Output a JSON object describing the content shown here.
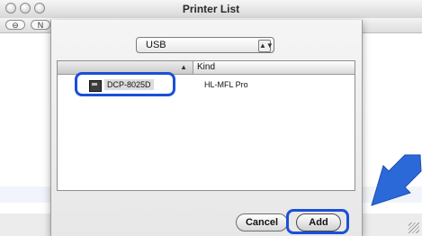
{
  "window": {
    "title": "Printer List",
    "toolbar_buttons": [
      "⊖",
      "N"
    ]
  },
  "sheet": {
    "connection_popup": {
      "selected": "USB"
    },
    "list": {
      "columns": [
        "",
        "Kind"
      ],
      "rows": [
        {
          "name": "DCP-8025D",
          "kind": "HL-MFL Pro"
        }
      ]
    },
    "buttons": {
      "cancel": "Cancel",
      "add": "Add"
    }
  },
  "annotations": {
    "highlight_color": "#1b4fd6",
    "arrow_color": "#2b69d8"
  },
  "icons": [
    "close-button-icon",
    "minimize-button-icon",
    "zoom-button-icon",
    "popup-arrow-icon",
    "sort-arrow-icon",
    "printer-icon",
    "resize-grip-icon",
    "pointer-arrow-icon"
  ]
}
